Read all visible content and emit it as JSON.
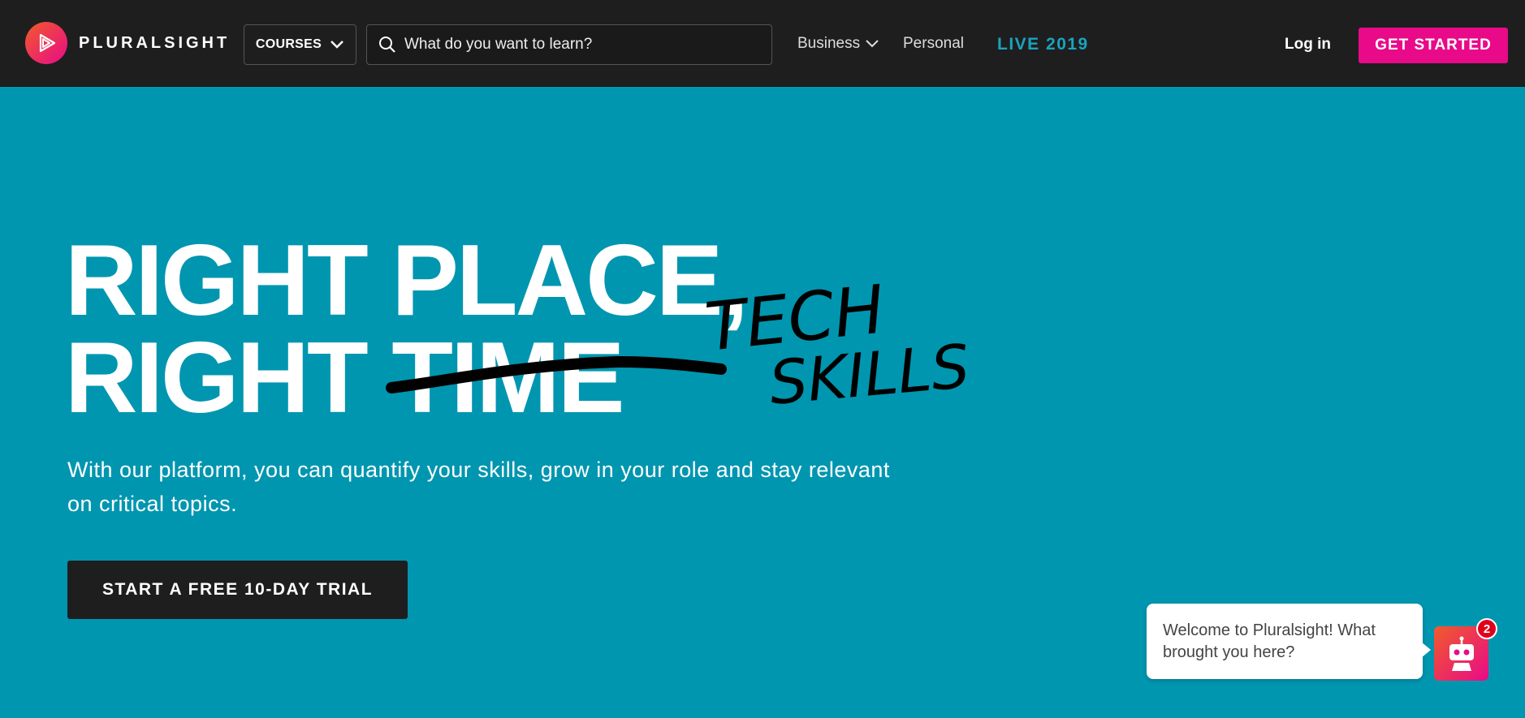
{
  "header": {
    "brand": "PLURALSIGHT",
    "logo_icon": "pluralsight-play-logo",
    "courses_label": "COURSES",
    "search_placeholder": "What do you want to learn?",
    "nav": {
      "business": "Business",
      "personal": "Personal",
      "live": "LIVE 2019"
    },
    "login": "Log in",
    "get_started": "GET STARTED",
    "colors": {
      "bar": "#1e1e1e",
      "accent": "#e80a89",
      "live": "#1aa3c0"
    }
  },
  "hero": {
    "line1": "RIGHT PLACE,",
    "line2_prefix": "RIGHT ",
    "line2_struck": "TIME",
    "handwritten_1": "TECH",
    "handwritten_2": "SKILLS",
    "subtitle": "With our platform, you can quantify your skills, grow in your role and stay relevant on critical topics.",
    "cta": "START A FREE 10-DAY TRIAL",
    "background": "#0096b0"
  },
  "chat": {
    "message": "Welcome to Pluralsight! What brought you here?",
    "badge_count": "2",
    "bot_icon": "robot-icon"
  }
}
